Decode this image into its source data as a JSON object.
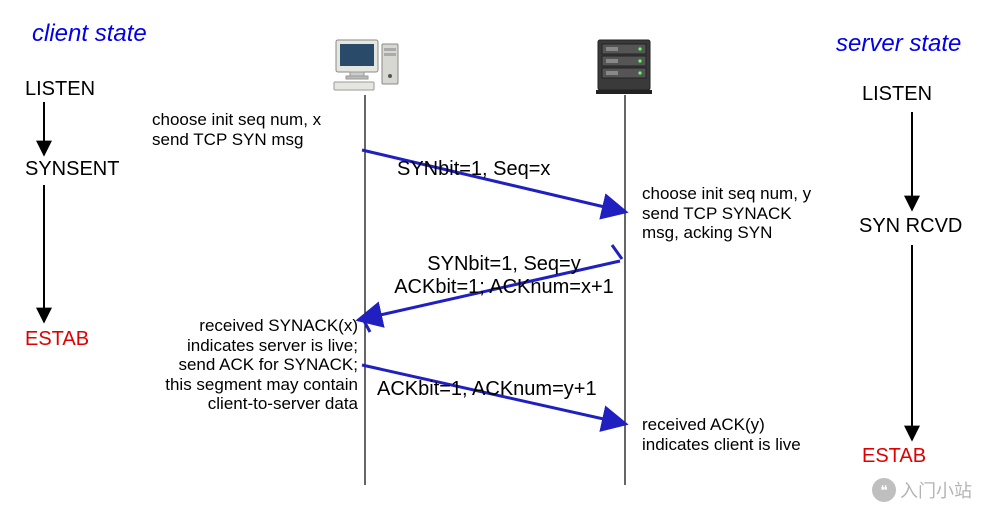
{
  "titles": {
    "client": "client state",
    "server": "server state"
  },
  "client_states": {
    "listen": "LISTEN",
    "synsent": "SYNSENT",
    "estab": "ESTAB"
  },
  "server_states": {
    "listen": "LISTEN",
    "synrcvd": "SYN RCVD",
    "estab": "ESTAB"
  },
  "client_notes": {
    "send_syn_l1": "choose init seq num, x",
    "send_syn_l2": "send TCP SYN msg",
    "recv_synack_l1": "received SYNACK(x)",
    "recv_synack_l2": "indicates server is live;",
    "recv_synack_l3": "send ACK for SYNACK;",
    "recv_synack_l4": "this segment may contain",
    "recv_synack_l5": "client-to-server data"
  },
  "server_notes": {
    "send_synack_l1": "choose init seq num, y",
    "send_synack_l2": "send TCP SYNACK",
    "send_synack_l3": "msg, acking SYN",
    "recv_ack_l1": "received ACK(y)",
    "recv_ack_l2": "indicates client is live"
  },
  "messages": {
    "syn": "SYNbit=1, Seq=x",
    "synack_l1": "SYNbit=1, Seq=y",
    "synack_l2": "ACKbit=1; ACKnum=x+1",
    "ack": "ACKbit=1, ACKnum=y+1"
  },
  "watermark": "入门小站"
}
